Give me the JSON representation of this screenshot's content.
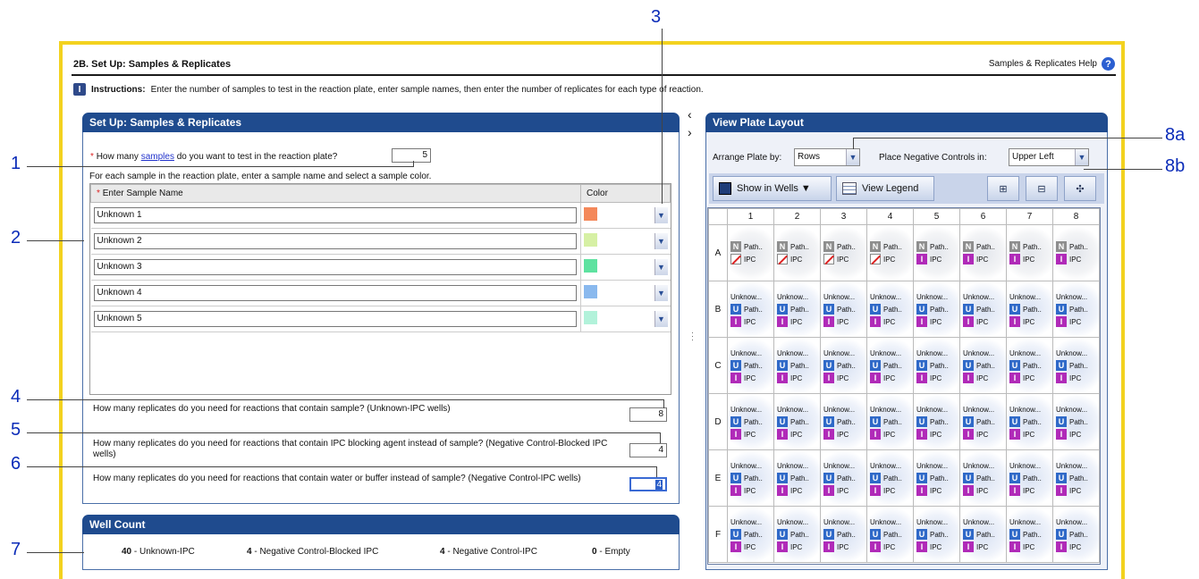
{
  "page": {
    "title": "2B. Set Up: Samples & Replicates",
    "help_label": "Samples & Replicates Help",
    "help_icon": "?",
    "instructions_icon": "I",
    "instructions_label": "Instructions:",
    "instructions_text": "Enter the number of samples to test in the reaction plate, enter sample names, then enter the number of replicates for each type of reaction."
  },
  "setup": {
    "header": "Set Up: Samples & Replicates",
    "required_mark": "*",
    "q_samples_pre": "How many",
    "q_samples_link": "samples",
    "q_samples_post": "do you want to test in the reaction plate?",
    "num_samples": "5",
    "sample_instruction": "For each sample in the reaction plate, enter a sample name and select a sample color.",
    "col_name": "Enter Sample Name",
    "col_color": "Color",
    "samples": [
      {
        "name": "Unknown 1",
        "color": "#f4885a"
      },
      {
        "name": "Unknown 2",
        "color": "#d6f0a4"
      },
      {
        "name": "Unknown 3",
        "color": "#5ee2a0"
      },
      {
        "name": "Unknown 4",
        "color": "#8ab9ee"
      },
      {
        "name": "Unknown 5",
        "color": "#b2f2da"
      }
    ],
    "q_unknown": "How many replicates do you need for reactions that contain sample? (Unknown-IPC wells)",
    "val_unknown": "8",
    "q_blocked": "How many replicates do you need for reactions that contain IPC blocking agent instead of sample? (Negative Control-Blocked IPC wells)",
    "val_blocked": "4",
    "q_ntc": "How many replicates do you need for reactions that contain water or buffer instead of sample? (Negative Control-IPC wells)",
    "val_ntc": "4"
  },
  "well_count": {
    "header": "Well Count",
    "items": [
      {
        "count": "40",
        "label": "- Unknown-IPC"
      },
      {
        "count": "4",
        "label": "- Negative Control-Blocked IPC"
      },
      {
        "count": "4",
        "label": "- Negative Control-IPC"
      },
      {
        "count": "0",
        "label": "- Empty"
      }
    ]
  },
  "plate": {
    "header": "View Plate Layout",
    "arrange_label": "Arrange Plate by:",
    "arrange_value": "Rows",
    "neg_label": "Place Negative Controls in:",
    "neg_value": "Upper Left",
    "show_in_wells": "Show in Wells ▼",
    "view_legend": "View Legend",
    "columns": [
      "1",
      "2",
      "3",
      "4",
      "5",
      "6",
      "7",
      "8"
    ],
    "rows": [
      "A",
      "B",
      "C",
      "D",
      "E",
      "F"
    ],
    "text_sample": "Unknow...",
    "text_path": "Path..",
    "text_ipc": "IPC",
    "badge_N": "N",
    "badge_U": "U",
    "badge_I": "I"
  },
  "callouts": [
    "1",
    "2",
    "3",
    "4",
    "5",
    "6",
    "7",
    "8a",
    "8b"
  ],
  "colors": {
    "header_blue": "#1f4b8e",
    "frame_yellow": "#f3d21f",
    "callout_blue": "#0a2bb8"
  }
}
